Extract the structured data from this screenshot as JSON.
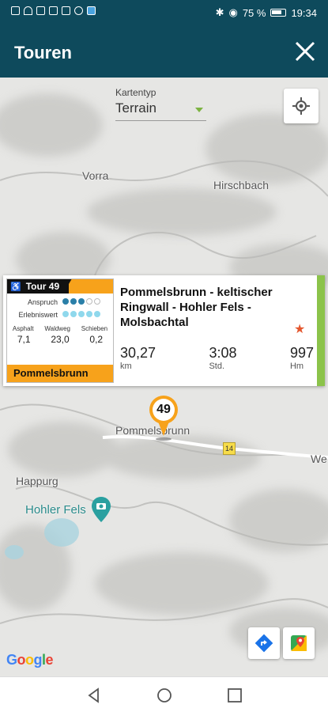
{
  "status": {
    "battery": "75 %",
    "time": "19:34"
  },
  "appbar": {
    "title": "Touren",
    "close_icon": "close-icon"
  },
  "map": {
    "maptype_label": "Kartentyp",
    "maptype_value": "Terrain",
    "places": [
      "Vorra",
      "Hirschbach",
      "Pommelsbrunn",
      "Happurg",
      "We"
    ],
    "poi": "Hohler Fels",
    "route_number": "14",
    "google": "Google"
  },
  "tour": {
    "badge_title": "Tour 49",
    "anspruch_label": "Anspruch",
    "anspruch_level": 3,
    "erlebniswert_label": "Erlebniswert",
    "erlebniswert_level": 5,
    "surface_labels": [
      "Asphalt",
      "Waldweg",
      "Schieben"
    ],
    "surface_values": [
      "7,1",
      "23,0",
      "0,2"
    ],
    "town": "Pommelsbrunn",
    "name": "Pommelsbrunn - keltischer Ringwall - Hohler Fels - Molsbachtal",
    "stats": [
      {
        "value": "30,27",
        "unit": "km"
      },
      {
        "value": "3:08",
        "unit": "Std."
      },
      {
        "value": "997",
        "unit": "Hm"
      }
    ],
    "marker_number": "49",
    "colors": {
      "accent_orange": "#f7a21b",
      "stripe_green": "#8bc34a",
      "dot_active": "#2db3d8",
      "dot_light": "#8fd8ec",
      "star": "#e4572e"
    }
  }
}
